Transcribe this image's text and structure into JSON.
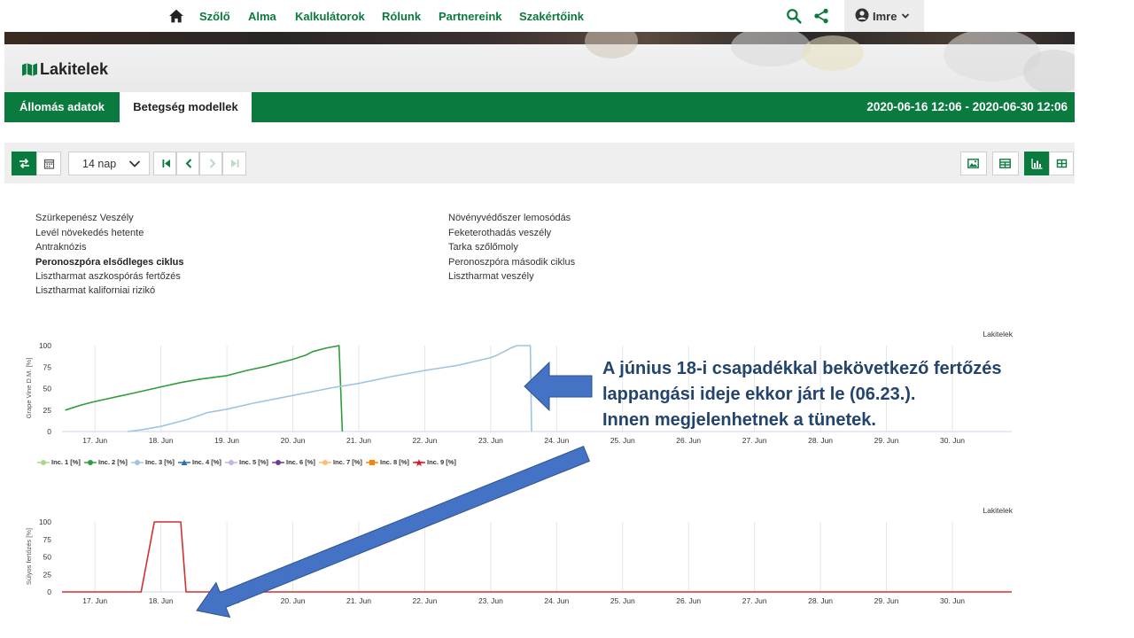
{
  "nav": {
    "items": [
      "Szőlő",
      "Alma",
      "Kalkulátorok",
      "Rólunk",
      "Partnereink",
      "Szakértőink"
    ],
    "user_name": "Imre"
  },
  "page": {
    "title": "Lakitelek"
  },
  "tabs": {
    "items": [
      "Állomás adatok",
      "Betegség modellek"
    ],
    "active": "Betegség modellek",
    "date_range": "2020-06-16 12:06 - 2020-06-30 12:06"
  },
  "toolbar": {
    "period": "14 nap"
  },
  "models": {
    "left": [
      "Szürkepenész Veszély",
      "Levél növekedés hetente",
      "Antraknózis",
      "Peronoszpóra elsődleges ciklus",
      "Lisztharmat aszkospórás fertőzés",
      "Lisztharmat kaliforniai rizikó"
    ],
    "right": [
      "Növényvédőszer lemosódás",
      "Feketerothadás veszély",
      "Tarka szőlőmoly",
      "Peronoszpóra második ciklus",
      "Lisztharmat veszély"
    ],
    "selected": "Peronoszpóra elsődleges ciklus"
  },
  "chart_data": [
    {
      "type": "line",
      "station_label": "Lakitelek",
      "ylabel": "Grape Vine D.M. [%]",
      "xlabel": "",
      "ylim": [
        0,
        100
      ],
      "yticks": [
        0,
        25,
        50,
        75,
        100
      ],
      "xticks": [
        "17. Jun",
        "18. Jun",
        "19. Jun",
        "20. Jun",
        "21. Jun",
        "22. Jun",
        "23. Jun",
        "24. Jun",
        "25. Jun",
        "26. Jun",
        "27. Jun",
        "28. Jun",
        "29. Jun",
        "30. Jun"
      ],
      "x_range": [
        16.5,
        30.9
      ],
      "grid": true,
      "legend_placement": "bottom-left",
      "series": [
        {
          "name": "Inc. 1 [%]",
          "color": "#a8d88a",
          "marker": "circle",
          "points": []
        },
        {
          "name": "Inc. 2 [%]",
          "color": "#2e9e3a",
          "marker": "circle",
          "points": [
            [
              16.55,
              25
            ],
            [
              16.8,
              31
            ],
            [
              17.0,
              35
            ],
            [
              17.3,
              40
            ],
            [
              17.6,
              45
            ],
            [
              18.0,
              52
            ],
            [
              18.3,
              57
            ],
            [
              18.6,
              61
            ],
            [
              19.0,
              65
            ],
            [
              19.3,
              71
            ],
            [
              19.6,
              76
            ],
            [
              20.0,
              84
            ],
            [
              20.2,
              89
            ],
            [
              20.3,
              93
            ],
            [
              20.5,
              97
            ],
            [
              20.7,
              100
            ],
            [
              20.75,
              0
            ]
          ]
        },
        {
          "name": "Inc. 3 [%]",
          "color": "#9ec5e0",
          "marker": "circle",
          "points": [
            [
              17.5,
              0
            ],
            [
              17.7,
              2
            ],
            [
              18.0,
              6
            ],
            [
              18.4,
              14
            ],
            [
              18.7,
              22
            ],
            [
              19.0,
              26
            ],
            [
              19.4,
              33
            ],
            [
              19.8,
              39
            ],
            [
              20.2,
              45
            ],
            [
              20.6,
              51
            ],
            [
              21.0,
              56
            ],
            [
              21.5,
              64
            ],
            [
              22.0,
              71
            ],
            [
              22.5,
              77
            ],
            [
              23.0,
              86
            ],
            [
              23.1,
              89
            ],
            [
              23.3,
              97
            ],
            [
              23.4,
              100
            ],
            [
              23.6,
              100
            ],
            [
              23.62,
              0
            ]
          ]
        },
        {
          "name": "Inc. 4 [%]",
          "color": "#2e6fb0",
          "marker": "triangle",
          "points": []
        },
        {
          "name": "Inc. 5 [%]",
          "color": "#c5b3e0",
          "marker": "circle",
          "points": []
        },
        {
          "name": "Inc. 6 [%]",
          "color": "#6a3d9a",
          "marker": "circle",
          "points": []
        },
        {
          "name": "Inc. 7 [%]",
          "color": "#fdbf6f",
          "marker": "circle",
          "points": []
        },
        {
          "name": "Inc. 8 [%]",
          "color": "#ff7f00",
          "marker": "square",
          "points": []
        },
        {
          "name": "Inc. 9 [%]",
          "color": "#e31a1c",
          "marker": "star",
          "points": []
        }
      ]
    },
    {
      "type": "line",
      "station_label": "Lakitelek",
      "ylabel": "Súlyos fertőzés [%]",
      "xlabel": "",
      "ylim": [
        0,
        100
      ],
      "yticks": [
        0,
        25,
        50,
        75,
        100
      ],
      "xticks": [
        "17. Jun",
        "18. Jun",
        "19. Jun",
        "20. Jun",
        "21. Jun",
        "22. Jun",
        "23. Jun",
        "24. Jun",
        "25. Jun",
        "26. Jun",
        "27. Jun",
        "28. Jun",
        "29. Jun",
        "30. Jun"
      ],
      "x_range": [
        16.5,
        30.9
      ],
      "grid": true,
      "series": [
        {
          "name": "Súlyos fertőzés",
          "color": "#d32f2f",
          "points": [
            [
              16.5,
              0
            ],
            [
              17.7,
              0
            ],
            [
              17.9,
              100
            ],
            [
              18.3,
              100
            ],
            [
              18.38,
              0
            ],
            [
              30.9,
              0
            ]
          ]
        }
      ]
    }
  ],
  "annotation": {
    "lines": [
      "A június 18-i csapadékkal bekövetkező fertőzés",
      "lappangási ideje ekkor járt le (06.23.).",
      "Innen megjelenhetnek a tünetek."
    ],
    "arrow_color": "#4472c4"
  }
}
